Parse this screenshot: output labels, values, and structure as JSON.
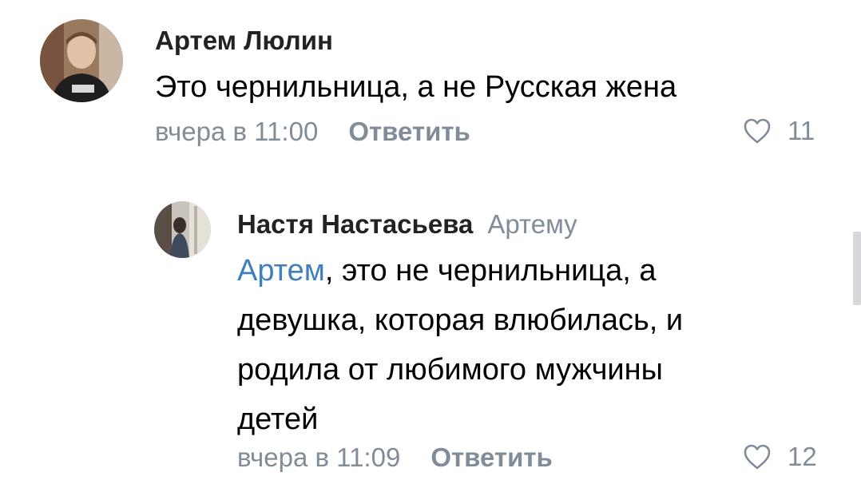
{
  "comments": [
    {
      "author": "Артем Люлин",
      "text": "Это чернильница, а не Русская жена",
      "time": "вчера в 11:00",
      "reply_label": "Ответить",
      "likes": "11",
      "avatar_icon": "user-photo"
    }
  ],
  "replies": [
    {
      "author": "Настя Настасьева",
      "reply_to": "Артему",
      "mention": "Артем",
      "text_lines": [
        ", это не чернильница, а",
        "девушка, которая влюбилась, и",
        "родила от любимого мужчины",
        "детей"
      ],
      "time": "вчера в 11:09",
      "reply_label": "Ответить",
      "likes": "12",
      "avatar_icon": "user-photo"
    }
  ],
  "icons": {
    "like": "heart-outline-icon"
  },
  "colors": {
    "secondary": "#818c99",
    "mention": "#3f7fbf",
    "text": "#000000"
  }
}
